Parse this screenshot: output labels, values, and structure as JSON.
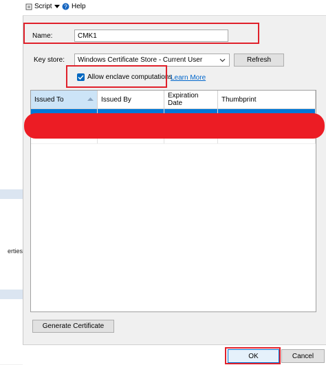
{
  "toolbar": {
    "script_label": "Script",
    "help_label": "Help"
  },
  "left_pane": {
    "partial_text": "erties"
  },
  "form": {
    "name_label": "Name:",
    "name_value": "CMK1",
    "key_store_label": "Key store:",
    "key_store_value": "Windows Certificate Store - Current User",
    "refresh_label": "Refresh",
    "enclave_label": "Allow enclave computations",
    "enclave_checked": true,
    "learn_more_label": "Learn More"
  },
  "grid": {
    "columns": [
      "Issued To",
      "Issued By",
      "Expiration Date",
      "Thumbprint"
    ],
    "selected_row_visible_text": [
      "",
      "",
      "",
      "",
      ""
    ]
  },
  "generate_label": "Generate Certificate",
  "footer": {
    "ok_label": "OK",
    "cancel_label": "Cancel"
  },
  "colors": {
    "highlight_red": "#e0202a",
    "selection_blue": "#0078d7",
    "link_blue": "#0066cc"
  }
}
